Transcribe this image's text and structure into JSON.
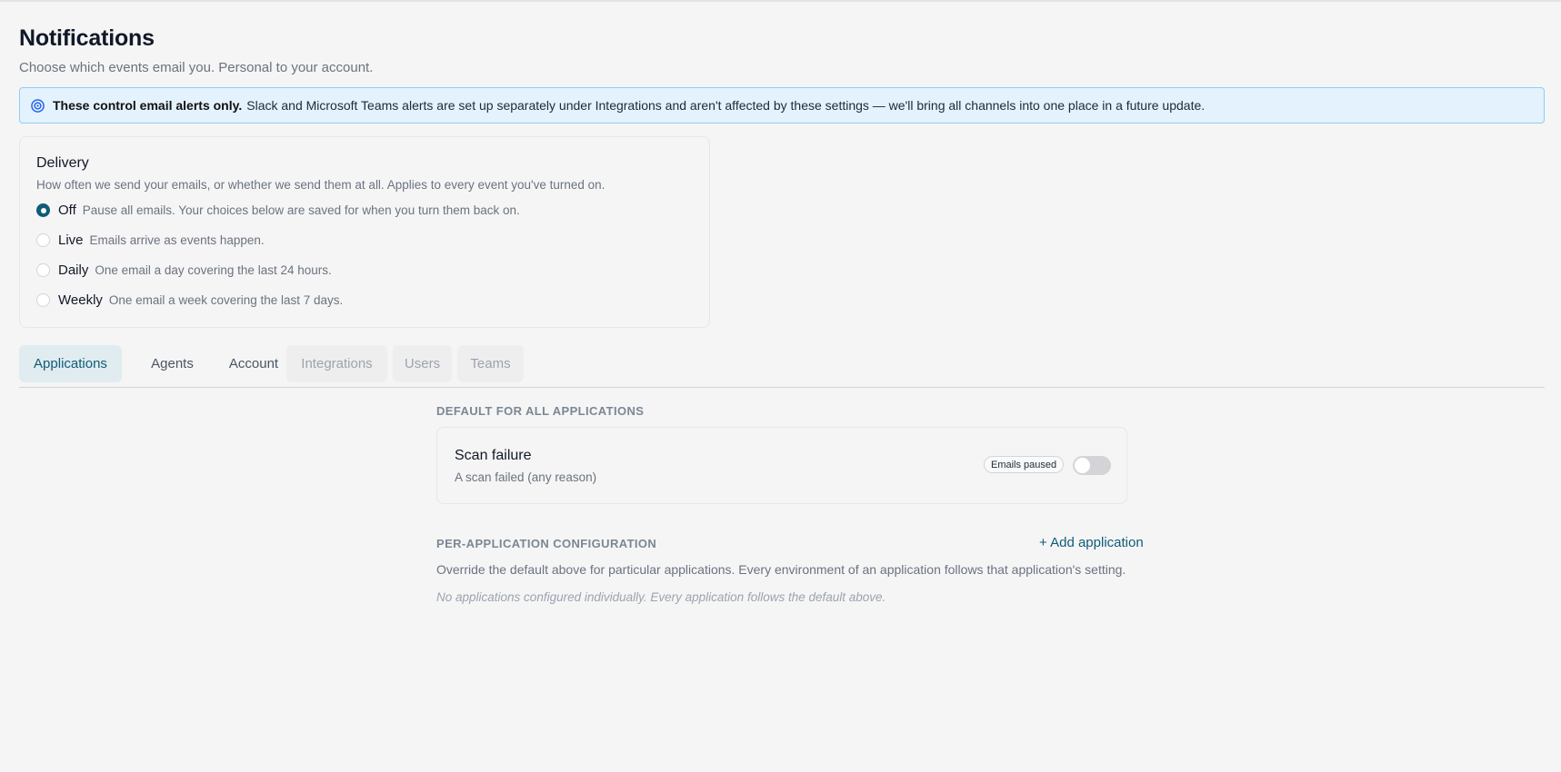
{
  "header": {
    "title": "Notifications",
    "subtitle": "Choose which events email you. Personal to your account."
  },
  "banner": {
    "icon": "info-circle-icon",
    "bold_text": "These control email alerts only.",
    "text": "Slack and Microsoft Teams alerts are set up separately under Integrations and aren't affected by these settings — we'll bring all channels into one place in a future update."
  },
  "delivery": {
    "title": "Delivery",
    "description": "How often we send your emails, or whether we send them at all. Applies to every event you've turned on.",
    "selected": "Off",
    "options": [
      {
        "label": "Off",
        "hint": "Pause all emails. Your choices below are saved for when you turn them back on."
      },
      {
        "label": "Live",
        "hint": "Emails arrive as events happen."
      },
      {
        "label": "Daily",
        "hint": "One email a day covering the last 24 hours."
      },
      {
        "label": "Weekly",
        "hint": "One email a week covering the last 7 days."
      }
    ]
  },
  "tabs": [
    {
      "label": "Applications",
      "state": "active"
    },
    {
      "label": "Agents",
      "state": "normal"
    },
    {
      "label": "Account",
      "state": "normal"
    },
    {
      "label": "Integrations",
      "state": "disabled"
    },
    {
      "label": "Users",
      "state": "disabled"
    },
    {
      "label": "Teams",
      "state": "disabled"
    }
  ],
  "default_section": {
    "label": "DEFAULT FOR ALL APPLICATIONS",
    "event": {
      "title": "Scan failure",
      "description": "A scan failed (any reason)",
      "badge": "Emails paused",
      "enabled": false
    }
  },
  "per_app_section": {
    "label": "PER-APPLICATION CONFIGURATION",
    "add_label": "+ Add application",
    "description": "Override the default above for particular applications. Every environment of an application follows that application's setting.",
    "empty_note": "No applications configured individually. Every application follows the default above."
  },
  "colors": {
    "accent": "#0f5c78",
    "banner_bg": "#e3f2fd",
    "banner_border": "#90cdf4",
    "page_bg": "#f5f5f5"
  }
}
